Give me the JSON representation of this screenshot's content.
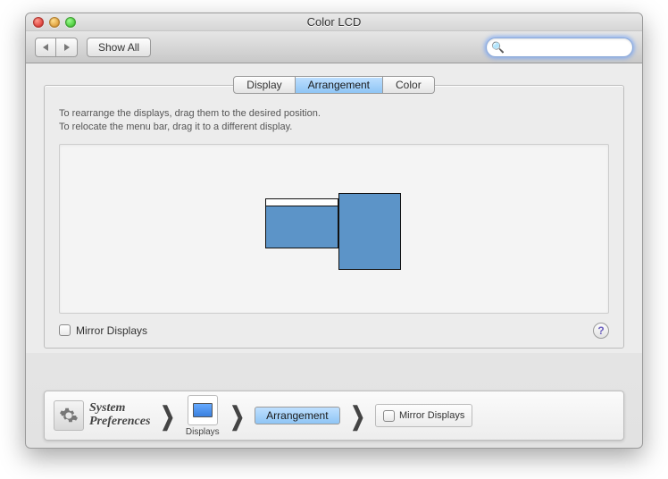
{
  "window": {
    "title": "Color LCD"
  },
  "toolbar": {
    "show_all": "Show All",
    "search_placeholder": ""
  },
  "tabs": {
    "display": "Display",
    "arrangement": "Arrangement",
    "color": "Color"
  },
  "panel": {
    "instr_line1": "To rearrange the displays, drag them to the desired position.",
    "instr_line2": "To relocate the menu bar, drag it to a different display.",
    "mirror_label": "Mirror Displays",
    "help_glyph": "?"
  },
  "breadcrumb": {
    "sys_line1": "System",
    "sys_line2": "Preferences",
    "displays": "Displays",
    "arrangement": "Arrangement",
    "mirror": "Mirror Displays"
  },
  "icons": {
    "search_glyph": "🔍"
  }
}
